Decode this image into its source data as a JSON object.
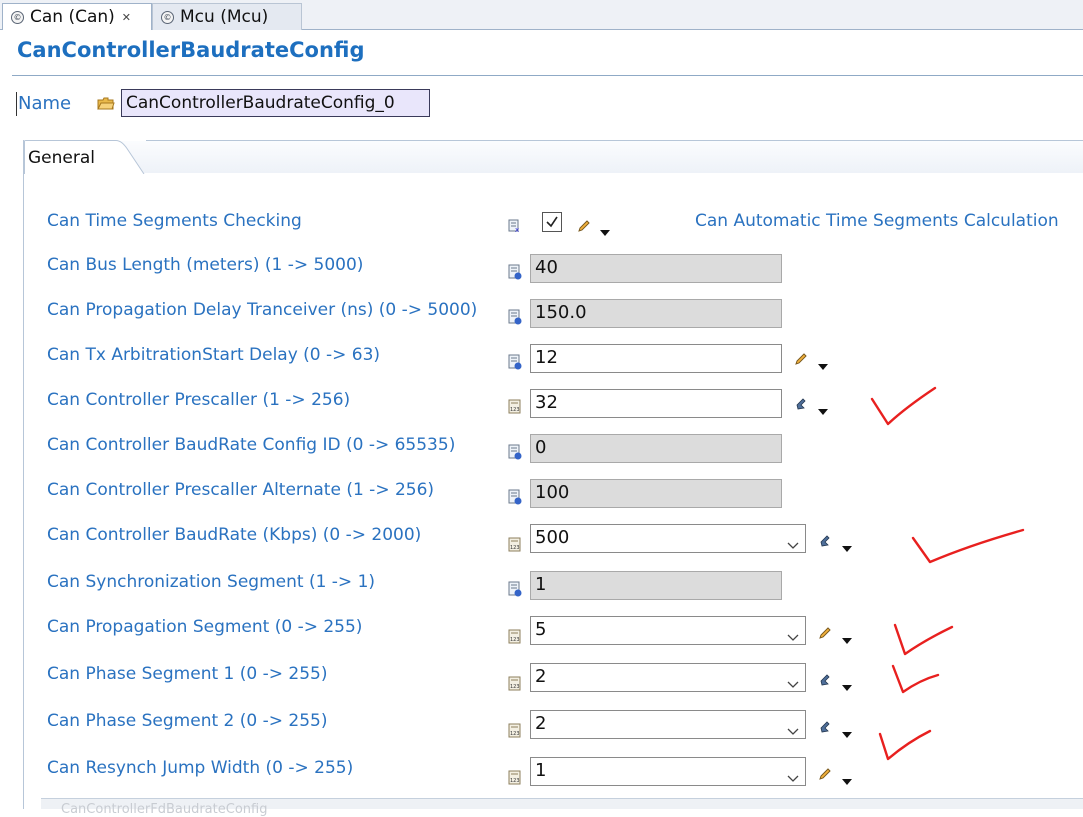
{
  "tabs": [
    {
      "label": "Can (Can)",
      "icon": "module-icon",
      "active": true
    },
    {
      "label": "Mcu (Mcu)",
      "icon": "module-icon",
      "active": false
    }
  ],
  "title": "CanControllerBaudrateConfig",
  "name": {
    "label": "Name",
    "value": "CanControllerBaudrateConfig_0"
  },
  "panel": {
    "tab_label": "General"
  },
  "fields": {
    "time_segments_checking": {
      "label": "Can Time Segments Checking",
      "checked": true,
      "link": "Can Automatic Time Segments Calculation"
    },
    "bus_length": {
      "label": "Can Bus Length (meters) (1 -> 5000)",
      "value": "40"
    },
    "prop_delay_tranceiver": {
      "label": "Can Propagation Delay Tranceiver (ns) (0 -> 5000)",
      "value": "150.0"
    },
    "tx_arbitration_start_delay": {
      "label": "Can Tx ArbitrationStart Delay (0 -> 63)",
      "value": "12"
    },
    "controller_prescaller": {
      "label": "Can Controller Prescaller (1 -> 256)",
      "value": "32"
    },
    "baudrate_config_id": {
      "label": "Can Controller BaudRate Config ID  (0 -> 65535)",
      "value": "0"
    },
    "prescaller_alternate": {
      "label": "Can Controller Prescaller Alternate (1 -> 256)",
      "value": "100"
    },
    "controller_baudrate": {
      "label": "Can Controller BaudRate (Kbps) (0 -> 2000)",
      "value": "500"
    },
    "sync_segment": {
      "label": "Can Synchronization Segment (1 -> 1)",
      "value": "1"
    },
    "propagation_segment": {
      "label": "Can Propagation Segment (0 -> 255)",
      "value": "5"
    },
    "phase_segment_1": {
      "label": "Can Phase Segment 1 (0 -> 255)",
      "value": "2"
    },
    "phase_segment_2": {
      "label": "Can Phase Segment 2 (0 -> 255)",
      "value": "2"
    },
    "resynch_jump_width": {
      "label": "Can Resynch Jump Width (0 -> 255)",
      "value": "1"
    }
  },
  "bottom_section_label": "CanControllerFdBaudrateConfig",
  "colors": {
    "label_blue": "#2a72c0",
    "title_blue": "#1d6fbf",
    "annotation_red": "#e8201f"
  }
}
